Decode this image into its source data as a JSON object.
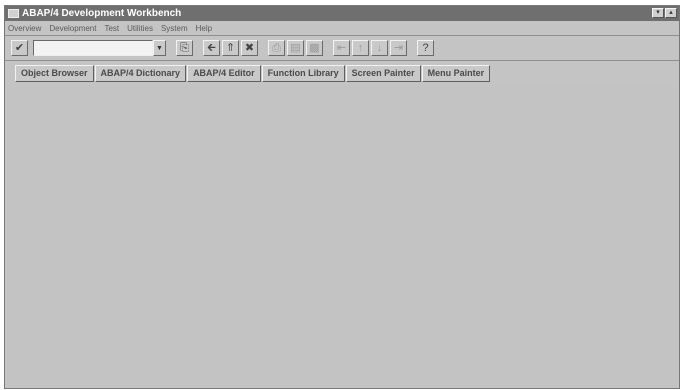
{
  "window": {
    "title": "ABAP/4 Development Workbench"
  },
  "menubar": {
    "items": [
      {
        "label": "Overview"
      },
      {
        "label": "Development"
      },
      {
        "label": "Test"
      },
      {
        "label": "Utilities"
      },
      {
        "label": "System"
      },
      {
        "label": "Help"
      }
    ]
  },
  "toolbar": {
    "command_field_value": "",
    "icons": [
      "enter-check-icon",
      "dropdown-arrow-icon",
      "save-icon",
      "back-icon",
      "exit-icon",
      "cancel-icon",
      "print-icon",
      "find-icon",
      "find-next-icon",
      "first-page-icon",
      "previous-page-icon",
      "next-page-icon",
      "last-page-icon",
      "help-icon"
    ]
  },
  "appbar": {
    "buttons": [
      {
        "label": "Object Browser"
      },
      {
        "label": "ABAP/4 Dictionary"
      },
      {
        "label": "ABAP/4 Editor"
      },
      {
        "label": "Function Library"
      },
      {
        "label": "Screen Painter"
      },
      {
        "label": "Menu Painter"
      }
    ]
  },
  "colors": {
    "background": "#c4c4c4",
    "titlebar": "#6f6f6f"
  }
}
